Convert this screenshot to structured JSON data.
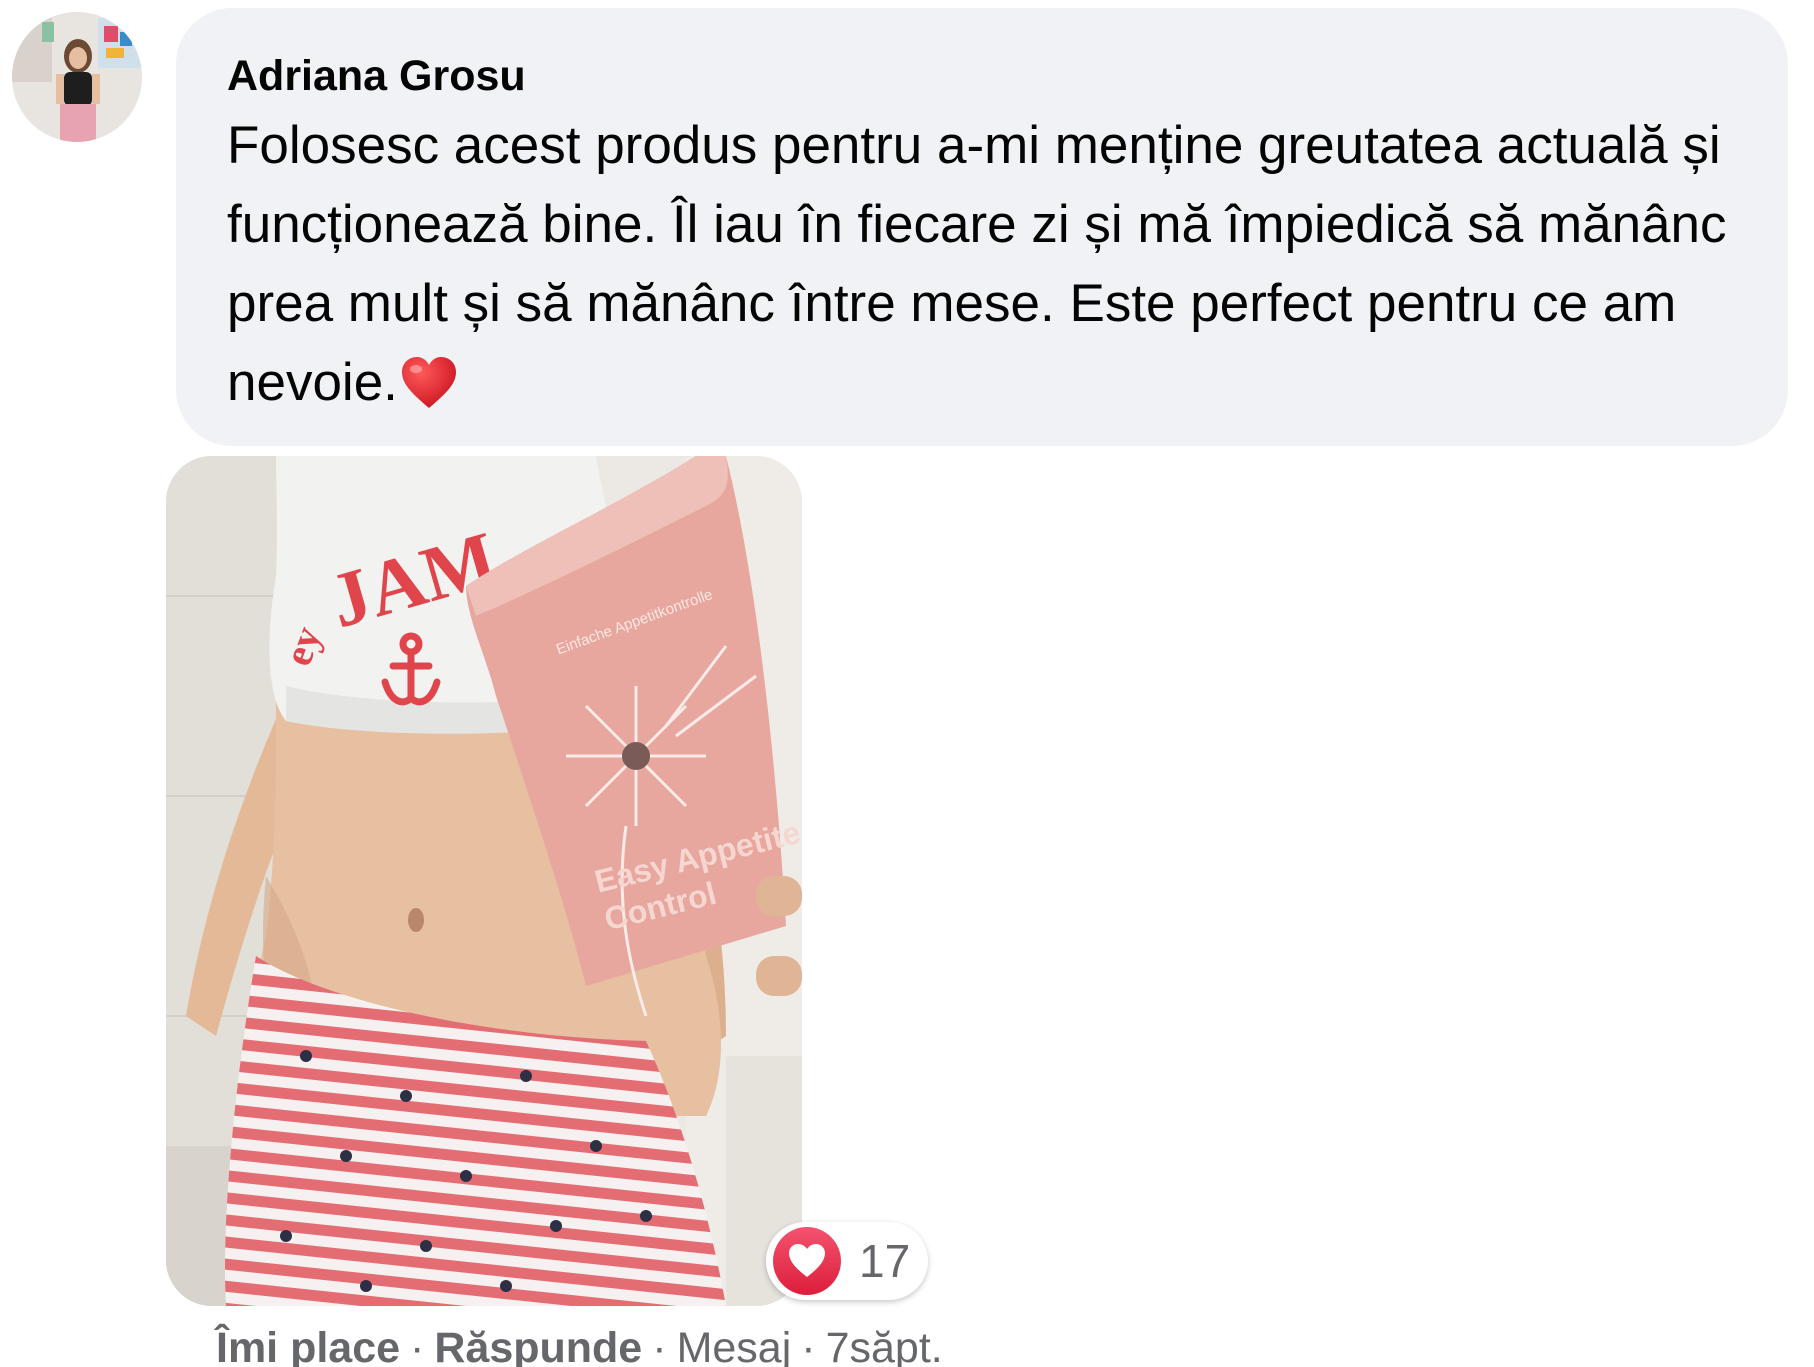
{
  "comment": {
    "author": "Adriana Grosu",
    "text": "Folosesc acest produs pentru a-mi menține greutatea actuală și funcționează bine. Îl iau în fiecare zi și mă împiedică să mănânc prea mult și să mănânc între mese. Este perfect pentru ce am nevoie.",
    "emoji": "heart-emoji",
    "attachment_icon": "photo-attachment",
    "reaction": {
      "icon": "love-reaction-icon",
      "count": "17",
      "color": "#e41e3f"
    },
    "actions": {
      "like": "Îmi place",
      "reply": "Răspunde",
      "message": "Mesaj",
      "separator": "·",
      "time": "7săpt."
    }
  },
  "colors": {
    "bubble_bg": "#f0f2f5",
    "text_primary": "#050505",
    "text_secondary": "#65676b"
  }
}
